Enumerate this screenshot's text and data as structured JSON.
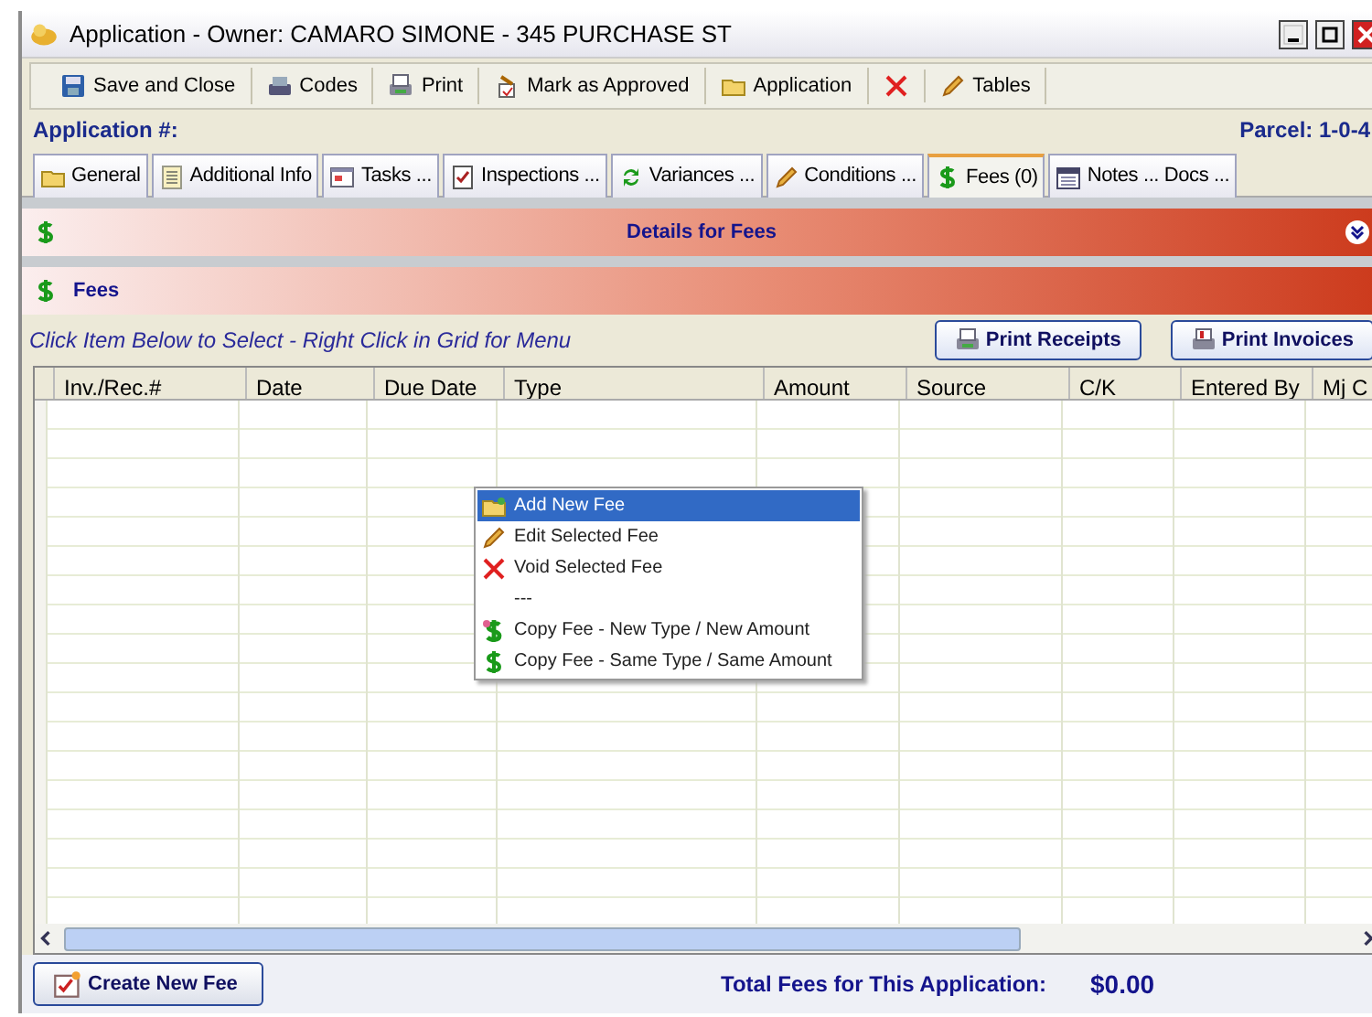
{
  "window": {
    "title": "Application - Owner: CAMARO SIMONE - 345 PURCHASE ST"
  },
  "toolbar": [
    {
      "kind": "save",
      "label": "Save and Close"
    },
    {
      "kind": "codes",
      "label": "Codes"
    },
    {
      "kind": "print",
      "label": "Print"
    },
    {
      "kind": "approve",
      "label": "Mark as Approved"
    },
    {
      "kind": "folder",
      "label": "Application"
    },
    {
      "kind": "delete"
    },
    {
      "kind": "pencil",
      "label": "Tables"
    }
  ],
  "application_label": "Application #:",
  "parcel_label": "Parcel: 1-0-4",
  "tabs": [
    {
      "kind": "folder",
      "label": "General",
      "selected": false
    },
    {
      "kind": "doc",
      "label": "Additional Info",
      "selected": false
    },
    {
      "kind": "window",
      "label": "Tasks ...",
      "selected": false
    },
    {
      "kind": "check",
      "label": "Inspections ...",
      "selected": false
    },
    {
      "kind": "refresh",
      "label": "Variances ...",
      "selected": false
    },
    {
      "kind": "pencil",
      "label": "Conditions ...",
      "selected": false
    },
    {
      "kind": "dollar",
      "label": "Fees (0)",
      "selected": true
    },
    {
      "kind": "calendar",
      "label": "Notes ... Docs ...",
      "selected": false
    }
  ],
  "details_header": "Details for Fees",
  "section_header": "Fees",
  "instruction": "Click Item Below to Select - Right Click in Grid for Menu",
  "buttons": [
    {
      "kind": "print",
      "label": "Print Receipts"
    },
    {
      "kind": "invoice",
      "label": "Print Invoices"
    }
  ],
  "table": {
    "columns": [
      "Inv./Rec.#",
      "Date",
      "Due Date",
      "Type",
      "Amount",
      "Source",
      "C/K",
      "Entered By",
      "Mj C"
    ]
  },
  "context_menu": [
    {
      "kind": "add",
      "label": "Add New Fee",
      "selected": true
    },
    {
      "kind": "edit",
      "label": "Edit Selected Fee",
      "selected": false
    },
    {
      "kind": "void",
      "label": "Void Selected Fee",
      "selected": false
    },
    {
      "kind": "none",
      "label": "---",
      "selected": false
    },
    {
      "kind": "dollar-new",
      "label": "Copy Fee - New Type / New Amount",
      "selected": false
    },
    {
      "kind": "dollar",
      "label": "Copy Fee - Same Type / Same Amount",
      "selected": false
    }
  ],
  "footer": {
    "button": "Create New Fee",
    "total_label": "Total Fees for This Application:",
    "total_value": "$0.00"
  }
}
